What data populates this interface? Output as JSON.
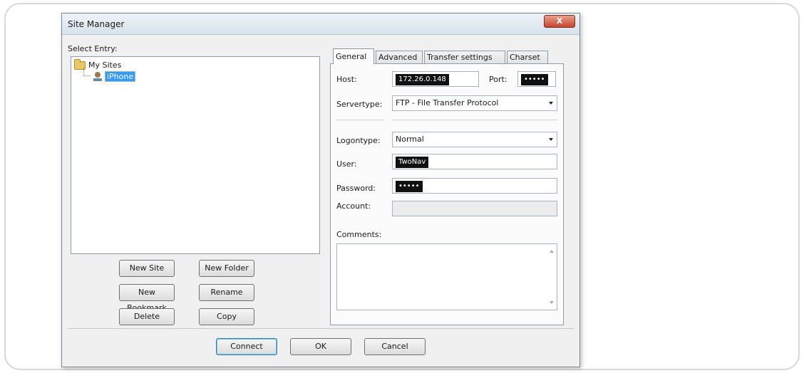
{
  "window": {
    "title": "Site Manager",
    "close_label": "X"
  },
  "left": {
    "select_entry_label": "Select Entry:",
    "tree": {
      "root_label": "My Sites",
      "site_label": "iPhone"
    },
    "buttons": {
      "new_site": "New Site",
      "new_folder": "New Folder",
      "new_bookmark": "New Bookmark",
      "rename": "Rename",
      "delete": "Delete",
      "copy": "Copy"
    }
  },
  "tabs": [
    "General",
    "Advanced",
    "Transfer settings",
    "Charset"
  ],
  "general": {
    "host_label": "Host:",
    "host_value": "172.26.0.148",
    "port_label": "Port:",
    "port_value": "•••••",
    "servertype_label": "Servertype:",
    "servertype_value": "FTP - File Transfer Protocol",
    "logontype_label": "Logontype:",
    "logontype_value": "Normal",
    "user_label": "User:",
    "user_value": "TwoNav",
    "password_label": "Password:",
    "password_value": "•••••",
    "account_label": "Account:",
    "comments_label": "Comments:"
  },
  "footer": {
    "connect": "Connect",
    "ok": "OK",
    "cancel": "Cancel"
  }
}
